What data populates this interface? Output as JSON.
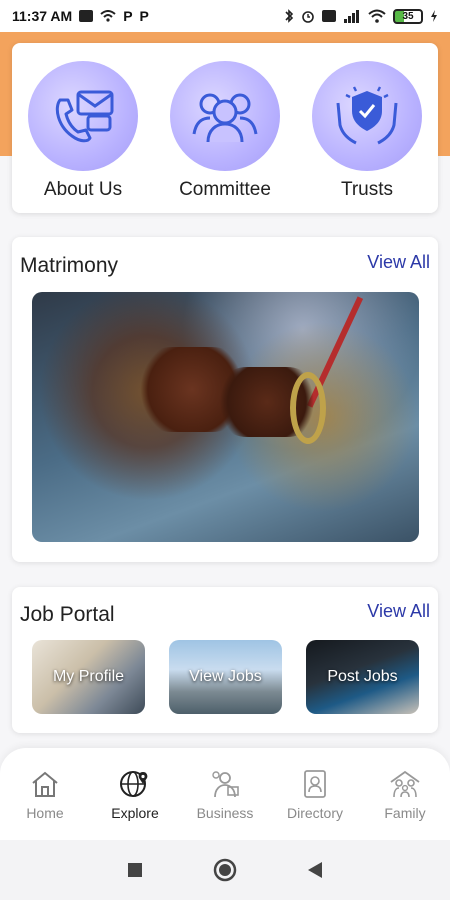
{
  "status_bar": {
    "time": "11:37 AM",
    "p1": "P",
    "p2": "P",
    "battery": "35"
  },
  "quick_links": [
    {
      "label": "About Us",
      "icon": "contact-phone-mail-icon"
    },
    {
      "label": "Committee",
      "icon": "people-group-icon"
    },
    {
      "label": "Trusts",
      "icon": "trust-shield-hands-icon"
    }
  ],
  "matrimony": {
    "title": "Matrimony",
    "view_all": "View All"
  },
  "job_portal": {
    "title": "Job Portal",
    "view_all": "View All",
    "items": [
      {
        "label": "My Profile"
      },
      {
        "label": "View Jobs"
      },
      {
        "label": "Post Jobs"
      }
    ]
  },
  "bottom_nav": {
    "items": [
      {
        "label": "Home",
        "icon": "home-icon"
      },
      {
        "label": "Explore",
        "icon": "explore-globe-icon",
        "active": true
      },
      {
        "label": "Business",
        "icon": "business-icon"
      },
      {
        "label": "Directory",
        "icon": "directory-icon"
      },
      {
        "label": "Family",
        "icon": "family-icon"
      }
    ]
  },
  "colors": {
    "accent": "#f3a35d",
    "link": "#2c39a8",
    "icon_bg": "#b9b2ff",
    "icon_fg": "#3a5bd8"
  }
}
